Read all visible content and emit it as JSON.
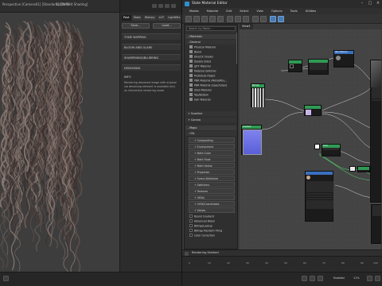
{
  "viewport": {
    "title": "Perspective [Camera01] [Standard] [Default Shading]",
    "tool_label": "SLOW PP",
    "colors": {
      "background": "#3d3d3d",
      "hair_dark": "#4a3c38",
      "hair_light": "#8a7a74"
    }
  },
  "render_panel": {
    "tabs": [
      "Post",
      "Stats",
      "History",
      "LUT",
      "LightMix"
    ],
    "active_tab": "Post",
    "buttons": {
      "save": "Save...",
      "load": "Load..."
    },
    "sections": [
      "TONE MAPPING",
      "BLOOM AND GLARE",
      "SHARPENING/BLURRING",
      "DENOISING"
    ],
    "info_title": "INFO",
    "info_text": "Rendering denoised image with original via denoising element is available only on interactive rendering mode"
  },
  "slate": {
    "title": "Slate Material Editor",
    "menu": [
      "Modes",
      "Material",
      "Edit",
      "Select",
      "View",
      "Options",
      "Tools",
      "Utilities"
    ],
    "view_tab": "View1",
    "search_placeholder": "Search by Name ...",
    "browser": {
      "materials_header": "- Materials",
      "general_header": "- General",
      "general_items": [
        "Physical Material",
        "Blend",
        "DirectX Shader",
        "Double Sided",
        "glTF Material",
        "Material Switcher",
        "Multi/Sub-Object",
        "PBR Material (Metal/Rou...",
        "PBR Material (Spec/Gloss)",
        "Shell Material",
        "Top/Bottom",
        "Hair Material"
      ],
      "scanline_header": "+ Scanline",
      "corona_header": "+ Corona",
      "maps_header": "- Maps",
      "osl_header": "- OSL",
      "osl_subgroups": [
        "+ Compositing",
        "+ Environment",
        "+ Math Color",
        "+ Math Float",
        "+ Math Vector",
        "+ Projection",
        "+ Scene Attributes",
        "+ Switchers",
        "+ Textures",
        "+ Utility",
        "+ UVW/Coordinates",
        "+ Values"
      ],
      "extra_items": [
        "Round Gradient",
        "Advanced Wood",
        "BitmapLookup",
        "Bitmap Random Tiling",
        "Color Correction"
      ]
    },
    "status_text": "Rendering finished",
    "timeline_numbers": [
      "0",
      "10",
      "20",
      "30",
      "40",
      "50",
      "60",
      "70",
      "80",
      "90",
      "100"
    ],
    "enabled_label": "Enabled",
    "zoom_label": "11%"
  },
  "nodes": {
    "material_name": "Hair Material",
    "bitmap_name": "Bitmap",
    "gradient_name": "Gradient",
    "color_name": "Color",
    "output_name": "Output"
  },
  "colors": {
    "accent_green": "#2f9a54",
    "accent_blue": "#3a70c0",
    "wire_white": "#d8d8d8",
    "wire_green": "#4fc06a",
    "node_bg": "#1b1b1b"
  }
}
